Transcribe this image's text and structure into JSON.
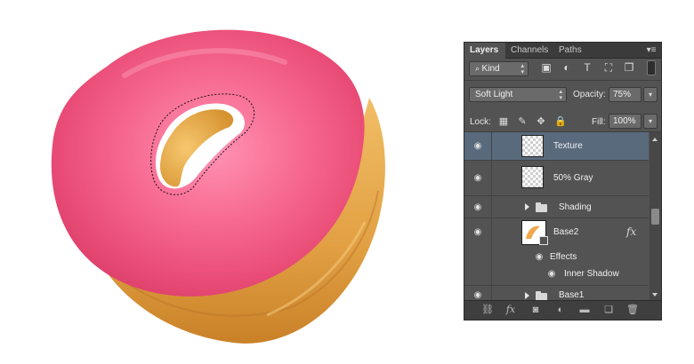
{
  "canvas": {
    "glaze_color": "#f06488",
    "dough_color": "#e6a84a",
    "selection": "marching-ants"
  },
  "panel": {
    "tabs": [
      {
        "label": "Layers",
        "active": true
      },
      {
        "label": "Channels",
        "active": false
      },
      {
        "label": "Paths",
        "active": false
      }
    ],
    "menu_icon": "panel-menu-icon",
    "filter": {
      "kind_label": "Kind",
      "icons": [
        "image-filter-icon",
        "adjustment-filter-icon",
        "type-filter-icon",
        "shape-filter-icon",
        "smartobject-filter-icon"
      ]
    },
    "blend_mode": "Soft Light",
    "opacity_label": "Opacity:",
    "opacity_value": "75%",
    "lock_label": "Lock:",
    "lock_icons": [
      "lock-transparent-icon",
      "lock-brush-icon",
      "lock-move-icon",
      "lock-all-icon"
    ],
    "fill_label": "Fill:",
    "fill_value": "100%",
    "layers": [
      {
        "name": "Texture",
        "selected": true
      },
      {
        "name": "50% Gray"
      },
      {
        "name": "Shading",
        "type": "group"
      },
      {
        "name": "Base2",
        "fx": "fx",
        "effects_label": "Effects",
        "effect": "Inner Shadow"
      },
      {
        "name": "Base1",
        "type": "group"
      }
    ],
    "bottom_icons": [
      "link-icon",
      "fx-icon",
      "mask-icon",
      "adjustment-icon",
      "folder-icon",
      "new-layer-icon",
      "trash-icon"
    ],
    "selected_color": "#596a7d"
  }
}
